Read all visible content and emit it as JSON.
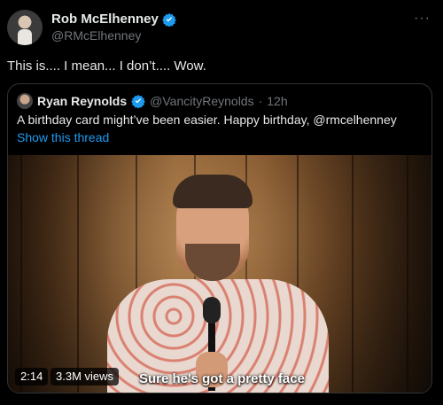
{
  "author": {
    "name": "Rob McElhenney",
    "handle": "@RMcElhenney"
  },
  "tweet": {
    "text": "This is.... I mean... I don’t.... Wow."
  },
  "quoted": {
    "name": "Ryan Reynolds",
    "handle": "@VancityReynolds",
    "separator": "·",
    "time": "12h",
    "text": "A birthday card might’ve been easier. Happy birthday, @rmcelhenney",
    "show_thread": "Show this thread",
    "video": {
      "duration": "2:14",
      "views": "3.3M views",
      "caption": "Sure he's got a pretty face"
    }
  },
  "icons": {
    "verified": "verified-badge-icon",
    "more": "more-options-icon"
  },
  "colors": {
    "background": "#000000",
    "text": "#e7e9ea",
    "muted": "#71767b",
    "link": "#1d9bf0",
    "verified": "#1d9bf0",
    "border": "#2f3336"
  }
}
